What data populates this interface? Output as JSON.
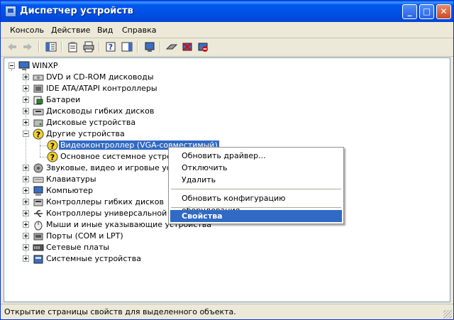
{
  "window": {
    "title": "Диспетчер устройств"
  },
  "title_buttons": {
    "minimize": "_",
    "maximize": "□",
    "close": "✕"
  },
  "menu": [
    "Консоль",
    "Действие",
    "Вид",
    "Справка"
  ],
  "toolbar": {
    "icons": [
      "back-icon",
      "forward-icon",
      "show-hide-console-tree-icon",
      "properties-icon",
      "print-icon",
      "help-icon",
      "show-hide-action-pane-icon",
      "scan-hardware-icon",
      "update-driver-icon",
      "uninstall-icon",
      "disable-icon"
    ]
  },
  "tree": {
    "root": "WINXP",
    "items": [
      {
        "label": "DVD и CD-ROM дисководы",
        "expanded": false,
        "icon": "cdrom-icon"
      },
      {
        "label": "IDE ATA/ATAPI контроллеры",
        "expanded": false,
        "icon": "ide-controller-icon"
      },
      {
        "label": "Батареи",
        "expanded": false,
        "icon": "battery-icon"
      },
      {
        "label": "Дисководы гибких дисков",
        "expanded": false,
        "icon": "floppy-icon"
      },
      {
        "label": "Дисковые устройства",
        "expanded": false,
        "icon": "disk-icon"
      },
      {
        "label": "Другие устройства",
        "expanded": true,
        "icon": "unknown-device-icon"
      },
      {
        "label": "Звуковые, видео и игровые устройства",
        "expanded": false,
        "icon": "sound-icon"
      },
      {
        "label": "Клавиатуры",
        "expanded": false,
        "icon": "keyboard-icon"
      },
      {
        "label": "Компьютер",
        "expanded": false,
        "icon": "computer-icon"
      },
      {
        "label": "Контроллеры гибких дисков",
        "expanded": false,
        "icon": "floppy-controller-icon"
      },
      {
        "label": "Контроллеры универсальной последовательной шины USB",
        "expanded": false,
        "icon": "usb-icon"
      },
      {
        "label": "Мыши и иные указывающие устройства",
        "expanded": false,
        "icon": "mouse-icon"
      },
      {
        "label": "Порты (COM и LPT)",
        "expanded": false,
        "icon": "port-icon"
      },
      {
        "label": "Сетевые платы",
        "expanded": false,
        "icon": "network-icon"
      },
      {
        "label": "Системные устройства",
        "expanded": false,
        "icon": "system-icon"
      }
    ],
    "other_devices_children": [
      {
        "label": "Видеоконтроллер (VGA-совместимый)",
        "selected": true
      },
      {
        "label": "Основное системное устройство",
        "selected": false
      }
    ]
  },
  "context_menu": {
    "items": [
      "Обновить драйвер...",
      "Отключить",
      "Удалить",
      "Обновить конфигурацию оборудования",
      "Свойства"
    ],
    "highlighted": "Свойства"
  },
  "status": "Открытие страницы свойств для выделенного объекта.",
  "colors": {
    "selection": "#316ac5",
    "titlebar": "#0058ee",
    "window_face": "#ece9d8"
  }
}
